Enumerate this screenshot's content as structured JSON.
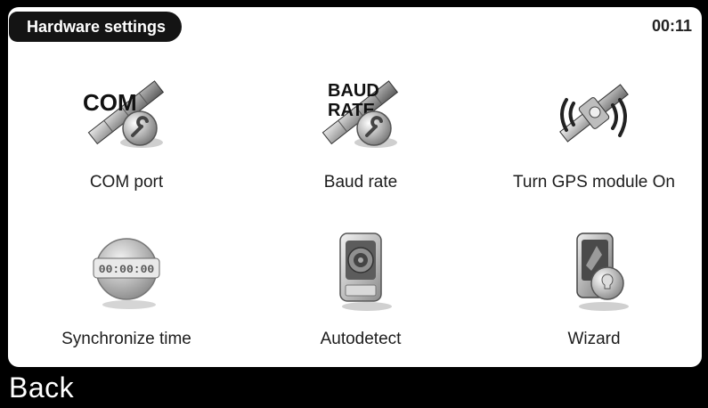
{
  "header": {
    "title": "Hardware settings",
    "clock": "00:11"
  },
  "menu": {
    "items": [
      {
        "label": "COM port",
        "icon": "com-port-satellite-wrench-icon",
        "icon_text": "COM"
      },
      {
        "label": "Baud rate",
        "icon": "baud-rate-satellite-wrench-icon",
        "icon_text": "BAUD RATE"
      },
      {
        "label": "Turn GPS module On",
        "icon": "gps-signal-satellite-icon"
      },
      {
        "label": "Synchronize time",
        "icon": "synchronize-clock-icon",
        "icon_text": "00:00:00"
      },
      {
        "label": "Autodetect",
        "icon": "autodetect-device-target-icon"
      },
      {
        "label": "Wizard",
        "icon": "wizard-device-lightbulb-icon"
      }
    ]
  },
  "footer": {
    "back_label": "Back"
  }
}
